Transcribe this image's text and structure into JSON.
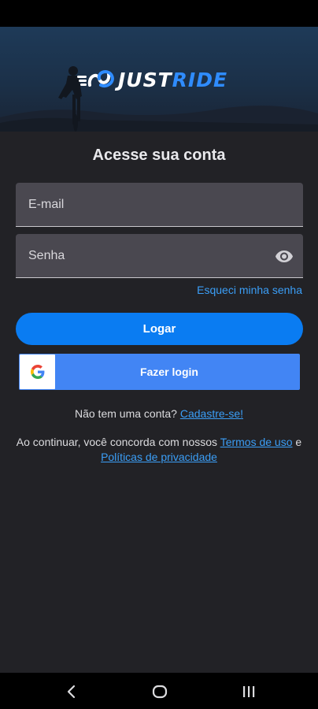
{
  "brand": {
    "name_part1": "JUST",
    "name_part2": "RIDE",
    "colors": {
      "accent": "#2f8cff",
      "primary_button": "#0a7cf2",
      "google": "#4285f4",
      "link": "#3b9ef6",
      "background": "#222226"
    }
  },
  "login": {
    "title": "Acesse sua conta",
    "email_placeholder": "E-mail",
    "password_placeholder": "Senha",
    "password_toggle_icon": "eye-icon",
    "forgot_password": "Esqueci minha senha",
    "login_button": "Logar",
    "google_button": "Fazer login",
    "google_icon": "google-g-icon"
  },
  "signup": {
    "prompt": "Não tem uma conta?",
    "link": "Cadastre-se!"
  },
  "legal": {
    "prefix": "Ao continuar, você concorda com nossos",
    "terms_link": "Termos de uso",
    "conjunction": "e",
    "privacy_link": "Políticas de privacidade"
  },
  "navigation": {
    "back_icon": "back-chevron-icon",
    "home_icon": "home-circle-icon",
    "recent_icon": "recent-apps-icon"
  }
}
